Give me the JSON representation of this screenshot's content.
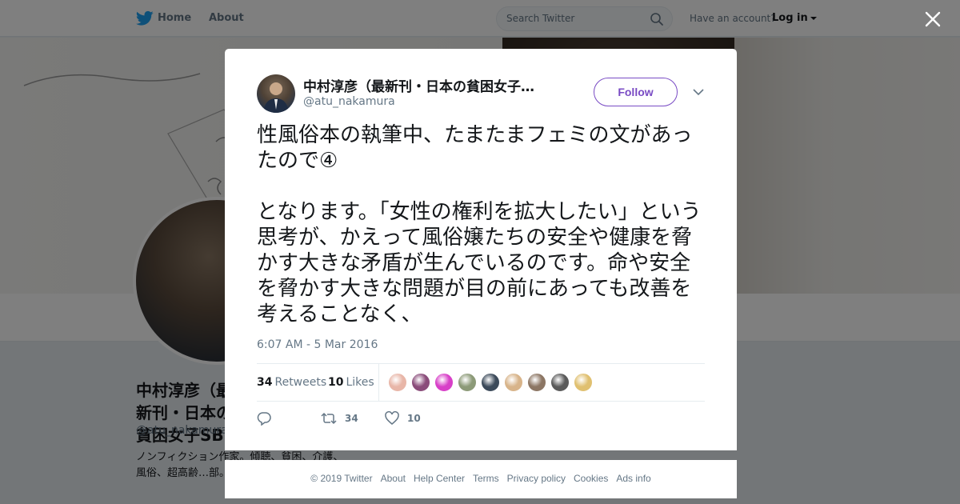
{
  "topnav": {
    "home_label": "Home",
    "about_label": "About",
    "search_placeholder": "Search Twitter",
    "have_account": "Have an account?",
    "login_label": "Log in"
  },
  "profile": {
    "name": "中村淳彦（最新刊・日本の貧困女子SB",
    "handle": "@atu_nakamura",
    "bio": "ノンフィクション作家。傾聴、貧困、介護、風俗、超高齢…部。聞けばすべて…"
  },
  "tweet": {
    "user_name": "中村淳彦（最新刊・日本の貧困女子…",
    "user_handle": "@atu_nakamura",
    "follow_label": "Follow",
    "paragraphs": [
      "性風俗本の執筆中、たまたまフェミの文があったので④",
      "となります。「女性の権利を拡大したい」という思考が、かえって風俗嬢たちの安全や健康を脅かす大きな矛盾が生んでいるのです。命や安全を脅かす大きな問題が目の前にあっても改善を考えることなく、"
    ],
    "timestamp": "6:07 AM - 5 Mar 2016",
    "retweets_count": "34",
    "retweets_label": "Retweets",
    "likes_count": "10",
    "likes_label": "Likes",
    "action_retweet_count": "34",
    "action_like_count": "10",
    "liker_colors": [
      "#e8b6a8",
      "#8a4c7a",
      "#d840c8",
      "#8c9a78",
      "#3c4a5a",
      "#d8b48a",
      "#8c7664",
      "#5a5a5a",
      "#e0c070"
    ]
  },
  "footer": {
    "links": [
      "© 2019 Twitter",
      "About",
      "Help Center",
      "Terms",
      "Privacy policy",
      "Cookies",
      "Ads info"
    ]
  },
  "colors": {
    "twitter_blue": "#1da1f2",
    "follow_purple": "#794bc4",
    "secondary_text": "#657786"
  }
}
